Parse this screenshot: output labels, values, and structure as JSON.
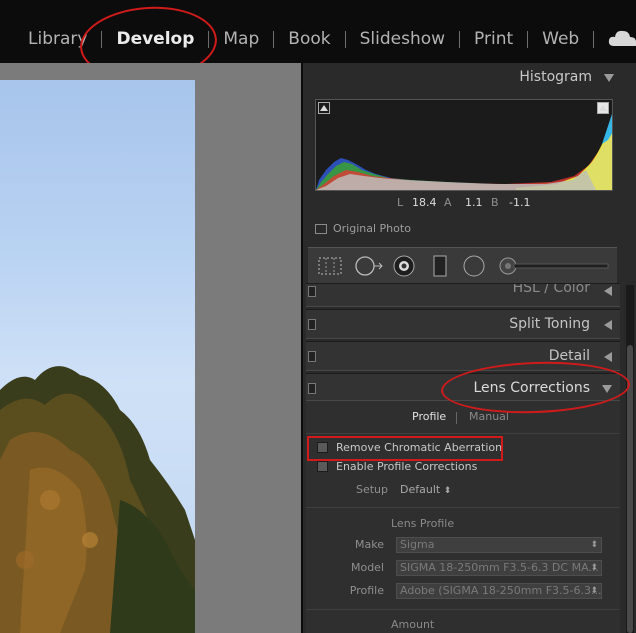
{
  "modules": {
    "items": [
      "Library",
      "Develop",
      "Map",
      "Book",
      "Slideshow",
      "Print",
      "Web"
    ],
    "active": "Develop"
  },
  "histogram": {
    "title": "Histogram",
    "lab": {
      "l_label": "L",
      "l_value": "18.4",
      "a_label": "A",
      "a_value": "1.1",
      "b_label": "B",
      "b_value": "-1.1"
    },
    "original_photo": "Original Photo"
  },
  "panels": {
    "hsl": "HSL / Color",
    "split_toning": "Split Toning",
    "detail": "Detail",
    "lens_corrections": "Lens Corrections"
  },
  "lens": {
    "tab_profile": "Profile",
    "tab_manual": "Manual",
    "remove_ca": "Remove Chromatic Aberration",
    "enable_profile": "Enable Profile Corrections",
    "setup_label": "Setup",
    "setup_value": "Default",
    "lens_profile_title": "Lens Profile",
    "make_label": "Make",
    "make_value": "Sigma",
    "model_label": "Model",
    "model_value": "SIGMA 18-250mm F3.5-6.3 DC MA...",
    "profile_label": "Profile",
    "profile_value": "Adobe (SIGMA 18-250mm F3.5-6.3...",
    "amount_title": "Amount"
  },
  "colors": {
    "annotation_red": "#d11b1b",
    "panel_bg": "#2a2a2a",
    "topbar_bg": "#0c0c0c"
  }
}
